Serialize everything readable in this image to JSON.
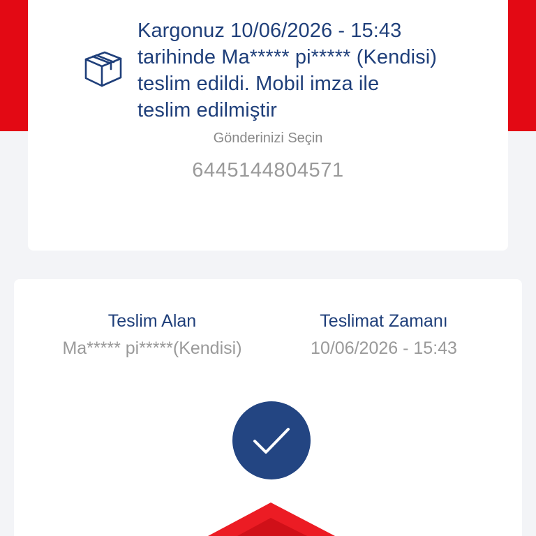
{
  "status": {
    "message": "Kargonuz 10/06/2026 - 15:43 tarihinde Ma***** pi***** (Kendisi) teslim edildi. Mobil imza ile teslim edilmiştir",
    "select_label": "Gönderinizi Seçin",
    "tracking_number": "6445144804571",
    "icon": "package-box-icon"
  },
  "delivery": {
    "receiver_title": "Teslim Alan",
    "receiver_value": "Ma***** pi*****(Kendisi)",
    "time_title": "Teslimat Zamanı",
    "time_value": "10/06/2026 - 15:43",
    "status_icon": "checkmark-icon"
  },
  "colors": {
    "brand_red": "#e30914",
    "brand_navy": "#1f3f7a",
    "check_bg": "#234582",
    "muted_text": "#9a9a9a",
    "page_bg": "#f3f4f7"
  }
}
